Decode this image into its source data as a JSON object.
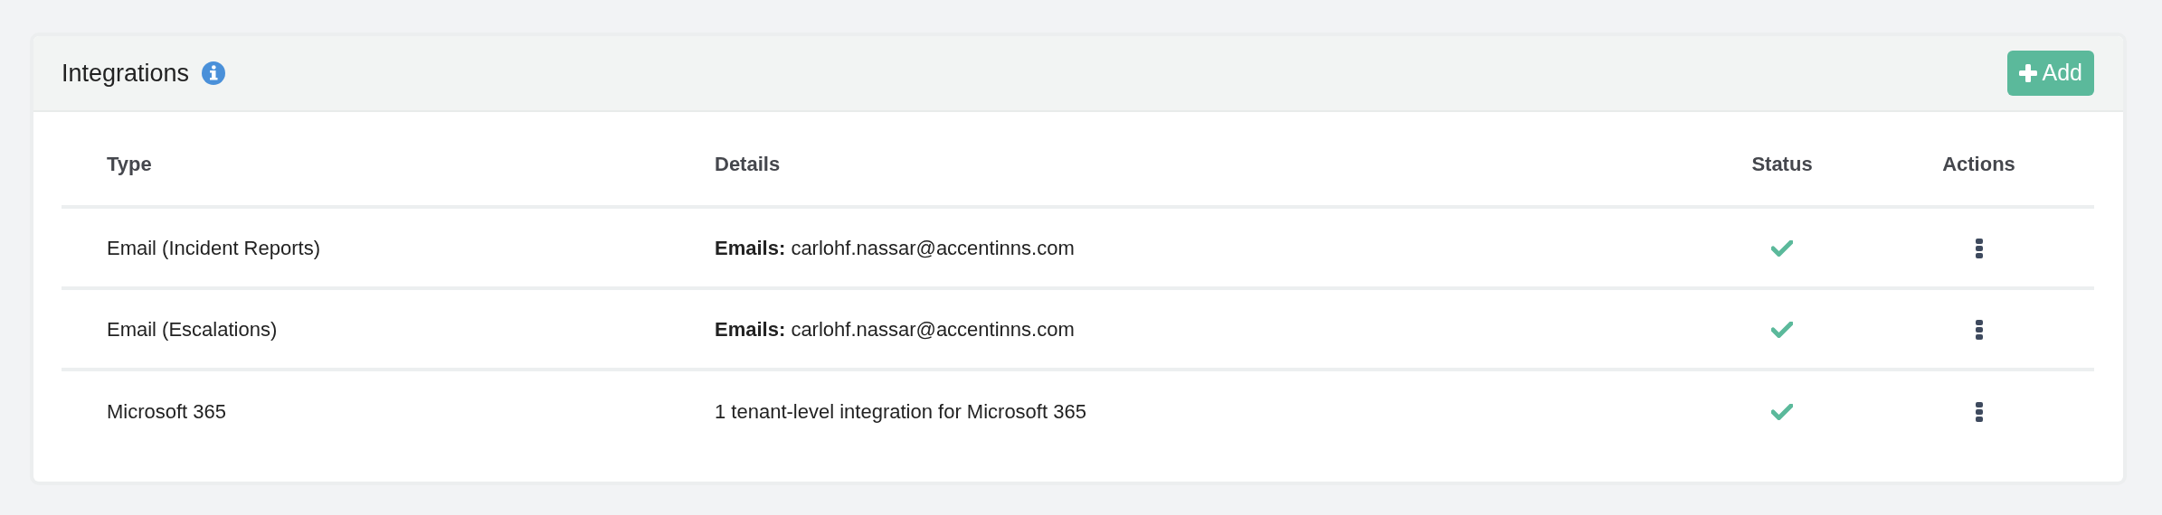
{
  "panel": {
    "title": "Integrations",
    "add_button": "Add"
  },
  "table": {
    "columns": [
      "Type",
      "Details",
      "Status",
      "Actions"
    ],
    "rows": [
      {
        "type": "Email (Incident Reports)",
        "details": "**Emails:** carlohf.nassar@accentinns.com",
        "active": true
      },
      {
        "type": "Email (Escalations)",
        "details": "**Emails:** carlohf.nassar@accentinns.com",
        "active": true
      },
      {
        "type": "Microsoft 365",
        "details": "1 tenant-level integration for Microsoft 365",
        "active": true
      }
    ]
  }
}
